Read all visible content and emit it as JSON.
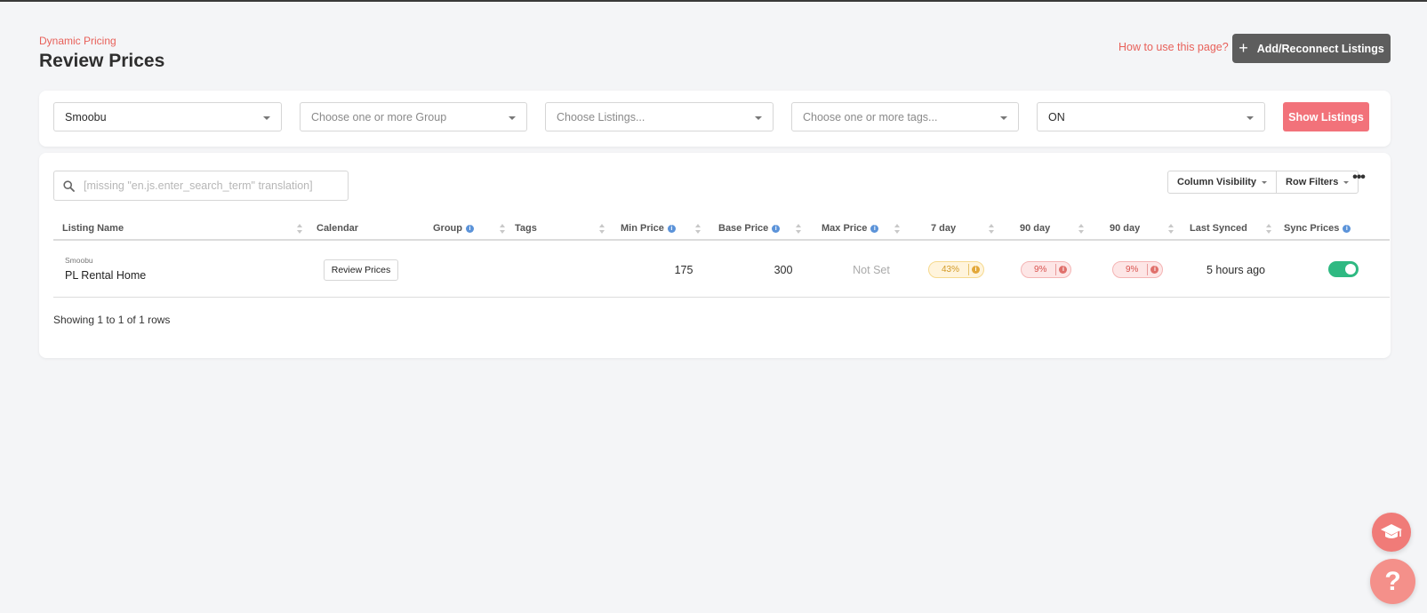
{
  "header": {
    "breadcrumb": "Dynamic Pricing",
    "title": "Review Prices",
    "help_link": "How to use this page?",
    "add_button": "Add/Reconnect Listings"
  },
  "filters": {
    "pms": {
      "value": "Smoobu"
    },
    "group": {
      "placeholder": "Choose one or more Group"
    },
    "listings": {
      "placeholder": "Choose Listings..."
    },
    "tags": {
      "placeholder": "Choose one or more tags..."
    },
    "status": {
      "value": "ON"
    },
    "show_button": "Show Listings"
  },
  "toolbar": {
    "search_placeholder": "[missing \"en.js.enter_search_term\" translation]",
    "column_visibility": "Column Visibility",
    "row_filters": "Row Filters",
    "more": "•••"
  },
  "table": {
    "columns": [
      "Listing Name",
      "Calendar",
      "Group",
      "Tags",
      "Min Price",
      "Base Price",
      "Max Price",
      "7 day",
      "90 day",
      "90 day",
      "Last Synced",
      "Sync Prices"
    ],
    "rows": [
      {
        "source": "Smoobu",
        "name": "PL Rental Home",
        "calendar_button": "Review Prices",
        "group": "",
        "tags": "",
        "min_price": "175",
        "base_price": "300",
        "max_price": "Not Set",
        "occ_7": "43%",
        "occ_90a": "9%",
        "occ_90b": "9%",
        "last_synced": "5 hours ago",
        "sync_prices": true
      }
    ],
    "footer": "Showing 1 to 1 of 1 rows"
  },
  "fab": {
    "help": "?"
  },
  "colors": {
    "accent": "#e8615a",
    "show_button": "#f2727a",
    "dark_button": "#5d5d5d",
    "toggle_on": "#2fb982",
    "info": "#5b93d9"
  }
}
